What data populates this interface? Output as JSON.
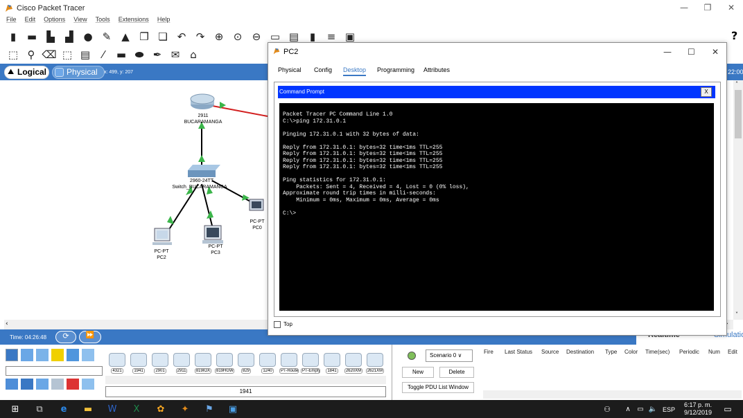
{
  "app": {
    "title": "Cisco Packet Tracer",
    "brand_color": "#3a78c4"
  },
  "menu": [
    "File",
    "Edit",
    "Options",
    "View",
    "Tools",
    "Extensions",
    "Help"
  ],
  "workspace": {
    "logical_label": "Logical",
    "physical_label": "Physical",
    "coords": "x: 499, y: 207",
    "right_time": "22:00"
  },
  "topology": {
    "router": {
      "model": "2911",
      "name": "BUCARAMANGA"
    },
    "switch": {
      "model": "2960-24TT",
      "name": "Switch_BUCARAMANGA"
    },
    "pc0": {
      "model": "PC-PT",
      "name": "PC0"
    },
    "pc2": {
      "model": "PC-PT",
      "name": "PC2"
    },
    "pc3": {
      "model": "PC-PT",
      "name": "PC3"
    },
    "link_colors": {
      "ethernet": "#000000",
      "serial": "#d21f1f",
      "status_up": "#3bb54a"
    }
  },
  "timebar": {
    "time": "Time: 04:26:48",
    "realtime": "Realtime",
    "simulation": "Simulation"
  },
  "device_panel": {
    "models": [
      "4321",
      "1941",
      "2901",
      "2911",
      "819IOX",
      "819HGW",
      "829",
      "1240",
      "PT-Router",
      "PT-Empty",
      "1841",
      "2620XM",
      "2621XM"
    ],
    "selected_model": "1941"
  },
  "pdu": {
    "scenario": "Scenario 0",
    "new": "New",
    "delete": "Delete",
    "toggle": "Toggle PDU List Window"
  },
  "event_list": {
    "columns": [
      "Fire",
      "Last Status",
      "Source",
      "Destination",
      "Type",
      "Color",
      "Time(sec)",
      "Periodic",
      "Num",
      "Edit"
    ]
  },
  "pc2_window": {
    "title": "PC2",
    "tabs": [
      "Physical",
      "Config",
      "Desktop",
      "Programming",
      "Attributes"
    ],
    "active_tab": "Desktop",
    "cmd_title": "Command Prompt",
    "cmd_close": "X",
    "cmd_output": "Packet Tracer PC Command Line 1.0\nC:\\>ping 172.31.0.1\n\nPinging 172.31.0.1 with 32 bytes of data:\n\nReply from 172.31.0.1: bytes=32 time<1ms TTL=255\nReply from 172.31.0.1: bytes=32 time<1ms TTL=255\nReply from 172.31.0.1: bytes=32 time<1ms TTL=255\nReply from 172.31.0.1: bytes=32 time<1ms TTL=255\n\nPing statistics for 172.31.0.1:\n    Packets: Sent = 4, Received = 4, Lost = 0 (0% loss),\nApproximate round trip times in milli-seconds:\n    Minimum = 0ms, Maximum = 0ms, Average = 0ms\n\nC:\\>",
    "top_label": "Top"
  },
  "taskbar": {
    "time": "6:17 p. m.",
    "date": "9/12/2019",
    "lang": "ESP"
  }
}
